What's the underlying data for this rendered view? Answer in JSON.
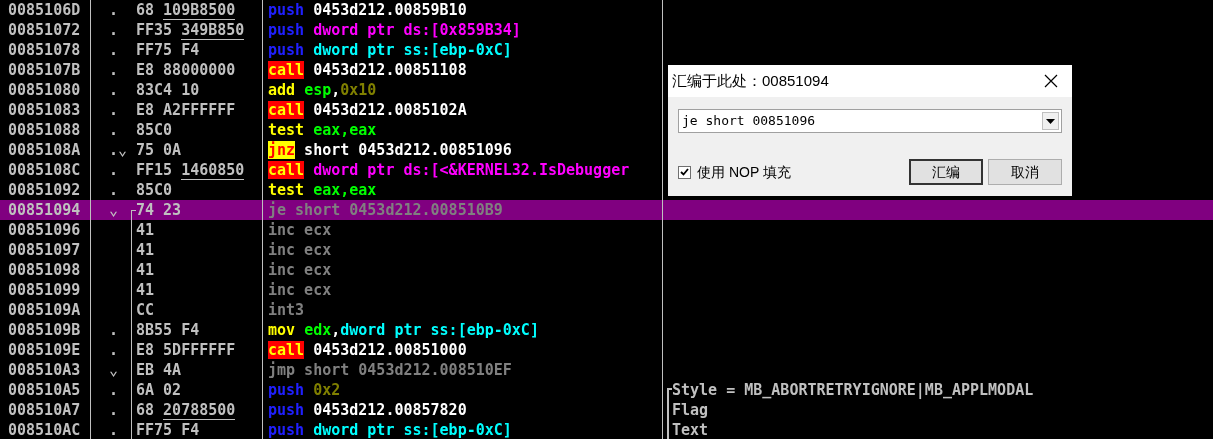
{
  "rows": [
    {
      "address": "0085106D",
      "marker": ".",
      "selected": false,
      "hex": "68 ",
      "hex_link": "109B8500",
      "tokens": [
        {
          "t": "push ",
          "kind": "push"
        },
        {
          "t": "0453d212.00859B10",
          "kind": "plain"
        }
      ]
    },
    {
      "address": "00851072",
      "marker": ".",
      "selected": false,
      "hex": "FF35 ",
      "hex_link": "349B850",
      "tokens": [
        {
          "t": "push ",
          "kind": "push"
        },
        {
          "t": "dword ptr ds:[0x859B34]",
          "kind": "mem_m"
        }
      ]
    },
    {
      "address": "00851078",
      "marker": ".",
      "selected": false,
      "hex": "FF75 F4",
      "tokens": [
        {
          "t": "push ",
          "kind": "push"
        },
        {
          "t": "dword ptr ss:[ebp-0xC]",
          "kind": "mem_c"
        }
      ]
    },
    {
      "address": "0085107B",
      "marker": ".",
      "selected": false,
      "hex": "E8 88000000",
      "tokens": [
        {
          "t": "call",
          "kind": "call"
        },
        {
          "t": " 0453d212.00851108",
          "kind": "plain"
        }
      ]
    },
    {
      "address": "00851080",
      "marker": ".",
      "selected": false,
      "hex": "83C4 10",
      "tokens": [
        {
          "t": "add ",
          "kind": "op"
        },
        {
          "t": "esp",
          "kind": "reg"
        },
        {
          "t": ",",
          "kind": "plain"
        },
        {
          "t": "0x10",
          "kind": "const"
        }
      ]
    },
    {
      "address": "00851083",
      "marker": ".",
      "selected": false,
      "hex": "E8 A2FFFFFF",
      "tokens": [
        {
          "t": "call",
          "kind": "call"
        },
        {
          "t": " 0453d212.0085102A",
          "kind": "plain"
        }
      ]
    },
    {
      "address": "00851088",
      "marker": ".",
      "selected": false,
      "hex": "85C0",
      "tokens": [
        {
          "t": "test ",
          "kind": "op"
        },
        {
          "t": "eax,eax",
          "kind": "reg"
        }
      ]
    },
    {
      "address": "0085108A",
      "marker": ".⌄",
      "selected": false,
      "hex": "75 0A",
      "tokens": [
        {
          "t": "jnz",
          "kind": "jcc"
        },
        {
          "t": " short 0453d212.00851096",
          "kind": "plain"
        }
      ]
    },
    {
      "address": "0085108C",
      "marker": ".",
      "selected": false,
      "hex": "FF15 ",
      "hex_link": "1460850",
      "tokens": [
        {
          "t": "call",
          "kind": "call"
        },
        {
          "t": " dword ptr ds:[<&KERNEL32.IsDebugger",
          "kind": "mem_m"
        }
      ]
    },
    {
      "address": "00851092",
      "marker": ".",
      "selected": false,
      "hex": "85C0",
      "tokens": [
        {
          "t": "test ",
          "kind": "op"
        },
        {
          "t": "eax,eax",
          "kind": "reg"
        }
      ]
    },
    {
      "address": "00851094",
      "marker": "⌄",
      "selected": true,
      "jump_bracket": {
        "kind": "start"
      },
      "hex": "74 23",
      "tokens": [
        {
          "t": "je short 0453d212.008510B9",
          "kind": "dim"
        }
      ]
    },
    {
      "address": "00851096",
      "selected": false,
      "jump_bracket": {
        "kind": "line"
      },
      "hex": "41",
      "tokens": [
        {
          "t": "inc ecx",
          "kind": "dim"
        }
      ]
    },
    {
      "address": "00851097",
      "selected": false,
      "jump_bracket": {
        "kind": "line"
      },
      "hex": "41",
      "tokens": [
        {
          "t": "inc ecx",
          "kind": "dim"
        }
      ]
    },
    {
      "address": "00851098",
      "selected": false,
      "jump_bracket": {
        "kind": "line"
      },
      "hex": "41",
      "tokens": [
        {
          "t": "inc ecx",
          "kind": "dim"
        }
      ]
    },
    {
      "address": "00851099",
      "selected": false,
      "jump_bracket": {
        "kind": "line"
      },
      "hex": "41",
      "tokens": [
        {
          "t": "inc ecx",
          "kind": "dim"
        }
      ]
    },
    {
      "address": "0085109A",
      "selected": false,
      "jump_bracket": {
        "kind": "line"
      },
      "hex": "CC",
      "tokens": [
        {
          "t": "int3",
          "kind": "dim"
        }
      ]
    },
    {
      "address": "0085109B",
      "marker": ".",
      "selected": false,
      "jump_bracket": {
        "kind": "line"
      },
      "hex": "8B55 F4",
      "tokens": [
        {
          "t": "mov ",
          "kind": "op"
        },
        {
          "t": "edx",
          "kind": "reg"
        },
        {
          "t": ",",
          "kind": "plain"
        },
        {
          "t": "dword ptr ss:[ebp-0xC]",
          "kind": "mem_c"
        }
      ]
    },
    {
      "address": "0085109E",
      "marker": ".",
      "selected": false,
      "jump_bracket": {
        "kind": "line"
      },
      "hex": "E8 5DFFFFFF",
      "tokens": [
        {
          "t": "call",
          "kind": "call"
        },
        {
          "t": " 0453d212.00851000",
          "kind": "plain"
        }
      ]
    },
    {
      "address": "008510A3",
      "marker": "⌄",
      "selected": false,
      "jump_bracket": {
        "kind": "line"
      },
      "hex": "EB 4A",
      "tokens": [
        {
          "t": "jmp short 0453d212.008510EF",
          "kind": "dim"
        }
      ]
    },
    {
      "address": "008510A5",
      "marker": ".",
      "selected": false,
      "jump_bracket": {
        "kind": "line"
      },
      "hex": "6A 02",
      "tokens": [
        {
          "t": "push ",
          "kind": "push"
        },
        {
          "t": "0x2",
          "kind": "const"
        }
      ],
      "comment": "Style = MB_ABORTRETRYIGNORE|MB_APPLMODAL",
      "comment_bracket": {
        "kind": "start"
      }
    },
    {
      "address": "008510A7",
      "marker": ".",
      "selected": false,
      "jump_bracket": {
        "kind": "line"
      },
      "hex": "68 ",
      "hex_link": "20788500",
      "tokens": [
        {
          "t": "push ",
          "kind": "push"
        },
        {
          "t": "0453d212.00857820",
          "kind": "plain"
        }
      ],
      "comment": "Flag",
      "comment_bracket": {
        "kind": "line"
      }
    },
    {
      "address": "008510AC",
      "marker": ".",
      "selected": false,
      "jump_bracket": {
        "kind": "line"
      },
      "hex": "FF75 F4",
      "tokens": [
        {
          "t": "push ",
          "kind": "push"
        },
        {
          "t": "dword ptr ss:[ebp-0xC]",
          "kind": "mem_c"
        }
      ],
      "comment": "Text",
      "comment_bracket": {
        "kind": "line"
      }
    }
  ],
  "dialog": {
    "title": "汇编于此处：00851094",
    "input_value": "je short 00851096",
    "checkbox": {
      "label": "使用 NOP 填充",
      "checked": true
    },
    "buttons": [
      "汇编",
      "取消"
    ]
  }
}
